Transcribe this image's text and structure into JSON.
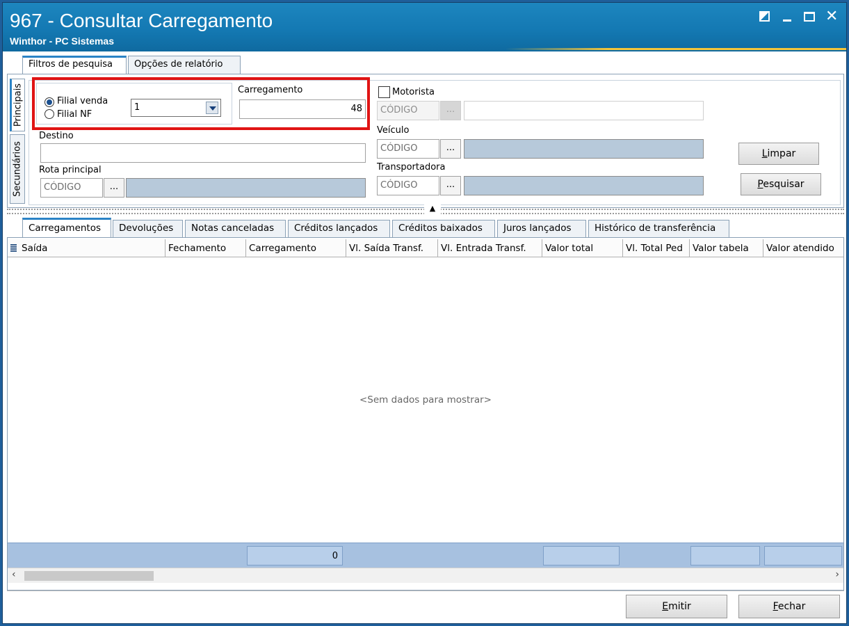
{
  "window": {
    "title": "967 - Consultar Carregamento",
    "subtitle": "Winthor - PC Sistemas"
  },
  "main_tabs": [
    {
      "label": "Filtros de pesquisa",
      "active": true
    },
    {
      "label": "Opções de relatório",
      "active": false
    }
  ],
  "side_tabs": [
    {
      "label": "Principais",
      "active": true
    },
    {
      "label": "Secundários",
      "active": false
    }
  ],
  "filters": {
    "filial_venda_label": "Filial venda",
    "filial_nf_label": "Filial NF",
    "filial_selected": "Filial venda",
    "filial_value": "1",
    "carregamento_label": "Carregamento",
    "carregamento_value": "48",
    "destino_label": "Destino",
    "destino_value": "",
    "rota_label": "Rota principal",
    "rota_code_placeholder": "CÓDIGO",
    "motorista_label": "Motorista",
    "motorista_checked": false,
    "motorista_code_placeholder": "CÓDIGO",
    "veiculo_label": "Veículo",
    "veiculo_code_placeholder": "CÓDIGO",
    "transportadora_label": "Transportadora",
    "transportadora_code_placeholder": "CÓDIGO",
    "ellipsis": "...",
    "limpar_prefix": "L",
    "limpar_rest": "impar",
    "pesquisar_prefix": "P",
    "pesquisar_rest": "esquisar"
  },
  "grid_tabs": [
    {
      "label": "Carregamentos",
      "active": true
    },
    {
      "label": "Devoluções",
      "active": false
    },
    {
      "label": "Notas canceladas",
      "active": false
    },
    {
      "label": "Créditos lançados",
      "active": false
    },
    {
      "label": "Créditos baixados",
      "active": false
    },
    {
      "label": "Juros lançados",
      "active": false
    },
    {
      "label": "Histórico de transferência",
      "active": false
    }
  ],
  "grid": {
    "columns": [
      "Saída",
      "Fechamento",
      "Carregamento",
      "Vl. Saída Transf.",
      "Vl. Entrada Transf.",
      "Valor total",
      "Vl. Total Ped",
      "Valor tabela",
      "Valor atendido"
    ],
    "no_data": "<Sem dados para mostrar>",
    "footer_carregamento_total": "0"
  },
  "actions": {
    "emitir_prefix": "E",
    "emitir_rest": "mitir",
    "fechar_prefix": "F",
    "fechar_rest": "echar"
  },
  "colors": {
    "titlebar": "#1479b3",
    "accent_tab": "#2b83c6",
    "highlight": "#e01414",
    "footer": "#a7c1e0"
  }
}
